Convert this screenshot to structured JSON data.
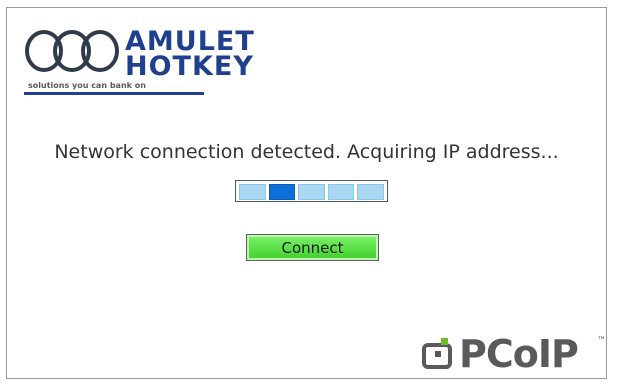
{
  "brand": {
    "line1": "AMULET",
    "line2": "HOTKEY",
    "tagline": "solutions you can bank on"
  },
  "status": {
    "message": "Network connection detected. Acquiring IP address..."
  },
  "progress": {
    "segments": 5,
    "active_index": 2
  },
  "actions": {
    "connect_label": "Connect"
  },
  "footer_logo": {
    "text": "PCoIP",
    "tm": "™"
  },
  "colors": {
    "brand_blue": "#1f3f8f",
    "progress_active": "#0a6fd6",
    "progress_idle": "#a9d9f2",
    "connect_green": "#3fcf2c"
  }
}
